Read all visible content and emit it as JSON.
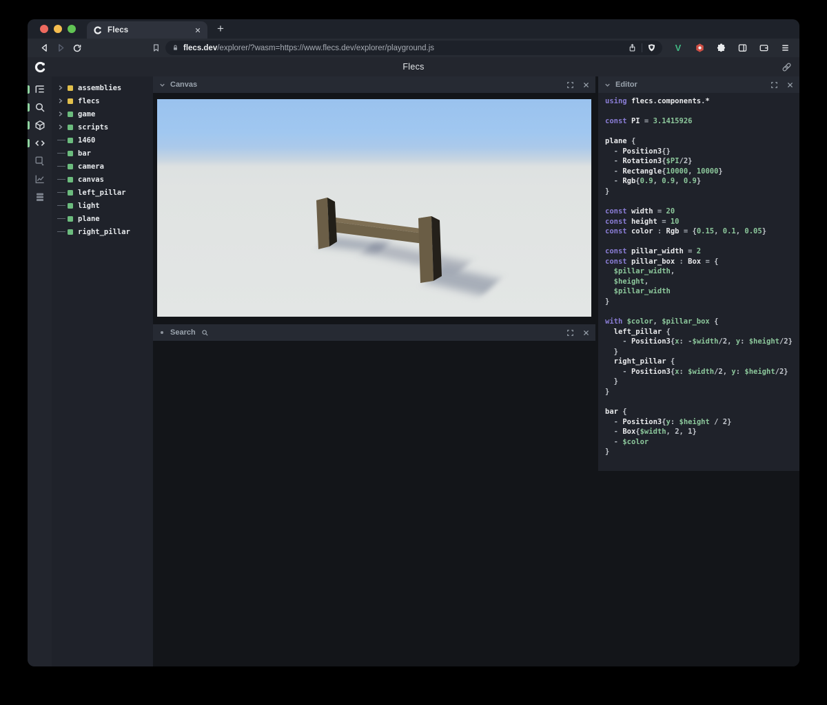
{
  "browser": {
    "tab_title": "Flecs",
    "new_tab_label": "+",
    "url_domain": "flecs.dev",
    "url_path": "/explorer/?wasm=https://www.flecs.dev/explorer/playground.js",
    "vue_badge": "V"
  },
  "header": {
    "title": "Flecs"
  },
  "nav_rail": {
    "items": [
      {
        "name": "tree-view",
        "active": true
      },
      {
        "name": "search",
        "active": true
      },
      {
        "name": "entities-cube",
        "active": true
      },
      {
        "name": "code",
        "active": true
      },
      {
        "name": "inspector-pointer",
        "active": false
      },
      {
        "name": "chart",
        "active": false
      },
      {
        "name": "stats-rows",
        "active": false
      }
    ]
  },
  "tree": {
    "items": [
      {
        "label": "assemblies",
        "dot": "#e2c04c",
        "expandable": true
      },
      {
        "label": "flecs",
        "dot": "#e2c04c",
        "expandable": true
      },
      {
        "label": "game",
        "dot": "#6cbc7e",
        "expandable": true
      },
      {
        "label": "scripts",
        "dot": "#6cbc7e",
        "expandable": true
      },
      {
        "label": "1460",
        "dot": "#6cbc7e",
        "expandable": false
      },
      {
        "label": "bar",
        "dot": "#6cbc7e",
        "expandable": false
      },
      {
        "label": "camera",
        "dot": "#6cbc7e",
        "expandable": false
      },
      {
        "label": "canvas",
        "dot": "#6cbc7e",
        "expandable": false
      },
      {
        "label": "left_pillar",
        "dot": "#6cbc7e",
        "expandable": false
      },
      {
        "label": "light",
        "dot": "#6cbc7e",
        "expandable": false
      },
      {
        "label": "plane",
        "dot": "#6cbc7e",
        "expandable": false
      },
      {
        "label": "right_pillar",
        "dot": "#6cbc7e",
        "expandable": false
      }
    ]
  },
  "panels": {
    "canvas": {
      "title": "Canvas"
    },
    "search": {
      "title": "Search"
    },
    "editor": {
      "title": "Editor"
    }
  },
  "scene": {
    "sky_color": "#9ac2ee",
    "ground_color": "#e0e3e2",
    "object_front_color": "#6b5e47",
    "object_side_color": "#221f18",
    "objects": [
      "left_pillar",
      "bar",
      "right_pillar"
    ]
  },
  "code": {
    "lines": [
      [
        [
          "k",
          "using "
        ],
        [
          "b",
          "flecs"
        ],
        [
          "p",
          "."
        ],
        [
          "b",
          "components"
        ],
        [
          "p",
          "."
        ],
        [
          "b",
          "*"
        ]
      ],
      [],
      [
        [
          "k",
          "const "
        ],
        [
          "b",
          "PI "
        ],
        [
          "o",
          "= "
        ],
        [
          "g",
          "3.1415926"
        ]
      ],
      [],
      [
        [
          "b",
          "plane "
        ],
        [
          "p",
          "{"
        ]
      ],
      [
        [
          "t",
          "  "
        ],
        [
          "o",
          "- "
        ],
        [
          "b",
          "Position3"
        ],
        [
          "p",
          "{}"
        ]
      ],
      [
        [
          "t",
          "  "
        ],
        [
          "o",
          "- "
        ],
        [
          "b",
          "Rotation3"
        ],
        [
          "p",
          "{"
        ],
        [
          "g",
          "$PI"
        ],
        [
          "p",
          "/2}"
        ]
      ],
      [
        [
          "t",
          "  "
        ],
        [
          "o",
          "- "
        ],
        [
          "b",
          "Rectangle"
        ],
        [
          "p",
          "{"
        ],
        [
          "g",
          "10000"
        ],
        [
          "p",
          ", "
        ],
        [
          "g",
          "10000"
        ],
        [
          "p",
          "}"
        ]
      ],
      [
        [
          "t",
          "  "
        ],
        [
          "o",
          "- "
        ],
        [
          "b",
          "Rgb"
        ],
        [
          "p",
          "{"
        ],
        [
          "g",
          "0.9"
        ],
        [
          "p",
          ", "
        ],
        [
          "g",
          "0.9"
        ],
        [
          "p",
          ", "
        ],
        [
          "g",
          "0.9"
        ],
        [
          "p",
          "}"
        ]
      ],
      [
        [
          "p",
          "}"
        ]
      ],
      [],
      [
        [
          "k",
          "const "
        ],
        [
          "b",
          "width "
        ],
        [
          "o",
          "= "
        ],
        [
          "g",
          "20"
        ]
      ],
      [
        [
          "k",
          "const "
        ],
        [
          "b",
          "height "
        ],
        [
          "o",
          "= "
        ],
        [
          "g",
          "10"
        ]
      ],
      [
        [
          "k",
          "const "
        ],
        [
          "b",
          "color "
        ],
        [
          "o",
          ": "
        ],
        [
          "b",
          "Rgb "
        ],
        [
          "o",
          "= "
        ],
        [
          "p",
          "{"
        ],
        [
          "g",
          "0.15"
        ],
        [
          "p",
          ", "
        ],
        [
          "g",
          "0.1"
        ],
        [
          "p",
          ", "
        ],
        [
          "g",
          "0.05"
        ],
        [
          "p",
          "}"
        ]
      ],
      [],
      [
        [
          "k",
          "const "
        ],
        [
          "b",
          "pillar_width "
        ],
        [
          "o",
          "= "
        ],
        [
          "g",
          "2"
        ]
      ],
      [
        [
          "k",
          "const "
        ],
        [
          "b",
          "pillar_box "
        ],
        [
          "o",
          ": "
        ],
        [
          "b",
          "Box "
        ],
        [
          "o",
          "= "
        ],
        [
          "p",
          "{"
        ]
      ],
      [
        [
          "t",
          "  "
        ],
        [
          "g",
          "$pillar_width"
        ],
        [
          "p",
          ","
        ]
      ],
      [
        [
          "t",
          "  "
        ],
        [
          "g",
          "$height"
        ],
        [
          "p",
          ","
        ]
      ],
      [
        [
          "t",
          "  "
        ],
        [
          "g",
          "$pillar_width"
        ]
      ],
      [
        [
          "p",
          "}"
        ]
      ],
      [],
      [
        [
          "k",
          "with "
        ],
        [
          "g",
          "$color"
        ],
        [
          "p",
          ", "
        ],
        [
          "g",
          "$pillar_box "
        ],
        [
          "p",
          "{"
        ]
      ],
      [
        [
          "t",
          "  "
        ],
        [
          "b",
          "left_pillar "
        ],
        [
          "p",
          "{"
        ]
      ],
      [
        [
          "t",
          "    "
        ],
        [
          "o",
          "- "
        ],
        [
          "b",
          "Position3"
        ],
        [
          "p",
          "{"
        ],
        [
          "g",
          "x"
        ],
        [
          "p",
          ": "
        ],
        [
          "o",
          "-"
        ],
        [
          "g",
          "$width"
        ],
        [
          "p",
          "/2, "
        ],
        [
          "g",
          "y"
        ],
        [
          "p",
          ": "
        ],
        [
          "g",
          "$height"
        ],
        [
          "p",
          "/2}"
        ]
      ],
      [
        [
          "t",
          "  "
        ],
        [
          "p",
          "}"
        ]
      ],
      [
        [
          "t",
          "  "
        ],
        [
          "b",
          "right_pillar "
        ],
        [
          "p",
          "{"
        ]
      ],
      [
        [
          "t",
          "    "
        ],
        [
          "o",
          "- "
        ],
        [
          "b",
          "Position3"
        ],
        [
          "p",
          "{"
        ],
        [
          "g",
          "x"
        ],
        [
          "p",
          ": "
        ],
        [
          "g",
          "$width"
        ],
        [
          "p",
          "/2, "
        ],
        [
          "g",
          "y"
        ],
        [
          "p",
          ": "
        ],
        [
          "g",
          "$height"
        ],
        [
          "p",
          "/2}"
        ]
      ],
      [
        [
          "t",
          "  "
        ],
        [
          "p",
          "}"
        ]
      ],
      [
        [
          "p",
          "}"
        ]
      ],
      [],
      [
        [
          "b",
          "bar "
        ],
        [
          "p",
          "{"
        ]
      ],
      [
        [
          "t",
          "  "
        ],
        [
          "o",
          "- "
        ],
        [
          "b",
          "Position3"
        ],
        [
          "p",
          "{"
        ],
        [
          "g",
          "y"
        ],
        [
          "p",
          ": "
        ],
        [
          "g",
          "$height "
        ],
        [
          "p",
          "/ 2}"
        ]
      ],
      [
        [
          "t",
          "  "
        ],
        [
          "o",
          "- "
        ],
        [
          "b",
          "Box"
        ],
        [
          "p",
          "{"
        ],
        [
          "g",
          "$width"
        ],
        [
          "p",
          ", 2, 1}"
        ]
      ],
      [
        [
          "t",
          "  "
        ],
        [
          "o",
          "- "
        ],
        [
          "g",
          "$color"
        ]
      ],
      [
        [
          "p",
          "}"
        ]
      ]
    ]
  },
  "colors": {
    "accent_green": "#8fd4a0",
    "module_yellow": "#e2c04c",
    "entity_green": "#6cbc7e",
    "keyword_purple": "#8a7dd6",
    "code_green": "#8cc79b",
    "panel_header_bg": "#262a33",
    "panel_bg": "#1f222a",
    "dark_bg": "#131519"
  }
}
